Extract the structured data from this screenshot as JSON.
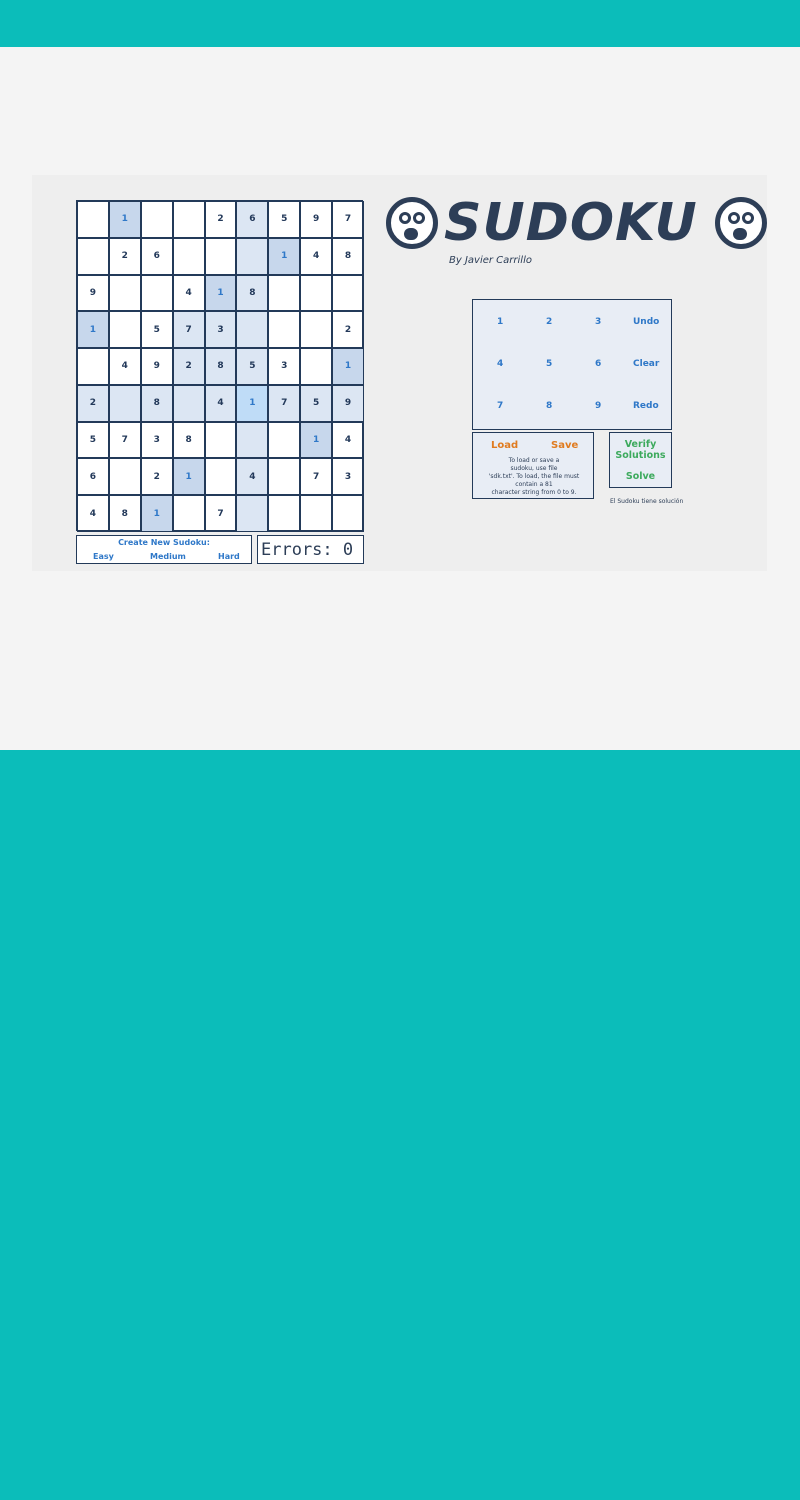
{
  "app": {
    "title": "SUDOKU",
    "byline": "By Javier Carrillo"
  },
  "grid": {
    "rows": [
      [
        "",
        "1",
        "",
        "",
        "2",
        "6",
        "5",
        "9",
        "7"
      ],
      [
        "",
        "2",
        "6",
        "",
        "",
        "",
        "1",
        "4",
        "8"
      ],
      [
        "9",
        "",
        "",
        "4",
        "1",
        "8",
        "",
        "",
        ""
      ],
      [
        "1",
        "",
        "5",
        "7",
        "3",
        "",
        "",
        "",
        "2"
      ],
      [
        "",
        "4",
        "9",
        "2",
        "8",
        "5",
        "3",
        "",
        "1"
      ],
      [
        "2",
        "",
        "8",
        "",
        "4",
        "1",
        "7",
        "5",
        "9"
      ],
      [
        "5",
        "7",
        "3",
        "8",
        "",
        "",
        "",
        "1",
        "4"
      ],
      [
        "6",
        "",
        "2",
        "1",
        "",
        "4",
        "",
        "7",
        "3"
      ],
      [
        "4",
        "8",
        "1",
        "",
        "7",
        "",
        "",
        "",
        ""
      ]
    ],
    "selected": [
      5,
      5
    ]
  },
  "create_new": {
    "title": "Create New Sudoku:",
    "easy": "Easy",
    "medium": "Medium",
    "hard": "Hard"
  },
  "errors": {
    "label": "Errors: 0"
  },
  "keypad": {
    "keys": [
      "1",
      "2",
      "3",
      "Undo",
      "4",
      "5",
      "6",
      "Clear",
      "7",
      "8",
      "9",
      "Redo"
    ]
  },
  "file": {
    "load": "Load",
    "save": "Save",
    "help_lines": [
      "To load or save a",
      "sudoku, use file",
      "'sdk.txt'. To load, the file must",
      "contain a 81",
      "character string from 0 to 9."
    ]
  },
  "actions": {
    "verify_line1": "Verify",
    "verify_line2": "Solutions",
    "solve": "Solve"
  },
  "status": "El Sudoku tiene solución",
  "colors": {
    "background": "#0bbdba",
    "panel": "#f4f4f4",
    "navy": "#233a59",
    "blue": "#2f78c8",
    "orange": "#e07b1f",
    "green": "#3daa5d"
  }
}
